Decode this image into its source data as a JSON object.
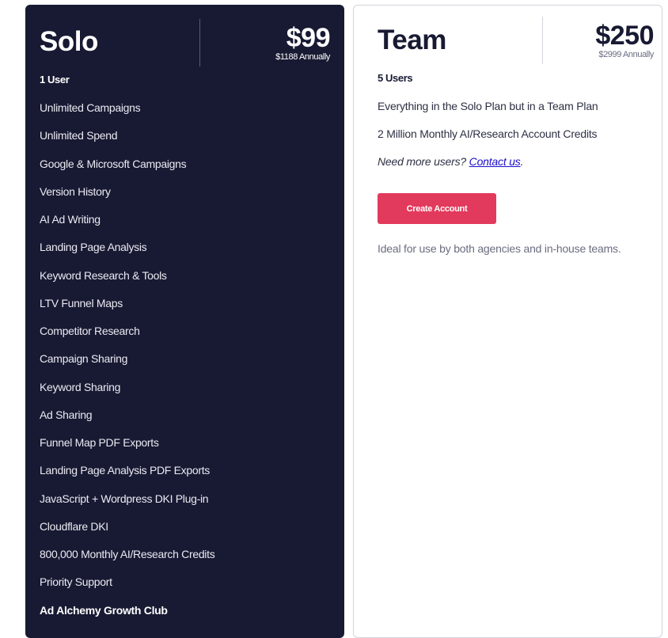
{
  "plans": {
    "solo": {
      "name": "Solo",
      "price": "$99",
      "annual": "$1188 Annually",
      "users": "1 User",
      "features": [
        "Unlimited Campaigns",
        "Unlimited Spend",
        "Google & Microsoft Campaigns",
        "Version History",
        "AI Ad Writing",
        "Landing Page Analysis",
        "Keyword Research & Tools",
        "LTV Funnel Maps",
        "Competitor Research",
        "Campaign Sharing",
        "Keyword Sharing",
        "Ad Sharing",
        "Funnel Map PDF Exports",
        "Landing Page Analysis PDF Exports",
        "JavaScript + Wordpress DKI Plug-in",
        "Cloudflare DKI",
        "800,000 Monthly AI/Research Credits",
        "Priority Support",
        "Ad Alchemy Growth Club"
      ]
    },
    "team": {
      "name": "Team",
      "price": "$250",
      "annual": "$2999 Annually",
      "users": "5 Users",
      "features": [
        "Everything in the Solo Plan but in a Team Plan",
        "2 Million Monthly AI/Research Account Credits"
      ],
      "more_users_text": "Need more users? ",
      "contact_link": "Contact us",
      "contact_suffix": ".",
      "button_label": "Create Account",
      "note": "Ideal for use by both agencies and in-house teams."
    }
  },
  "colors": {
    "solo_bg": "#181a33",
    "accent_button": "#e23a5c",
    "link": "#1a0dcc"
  }
}
